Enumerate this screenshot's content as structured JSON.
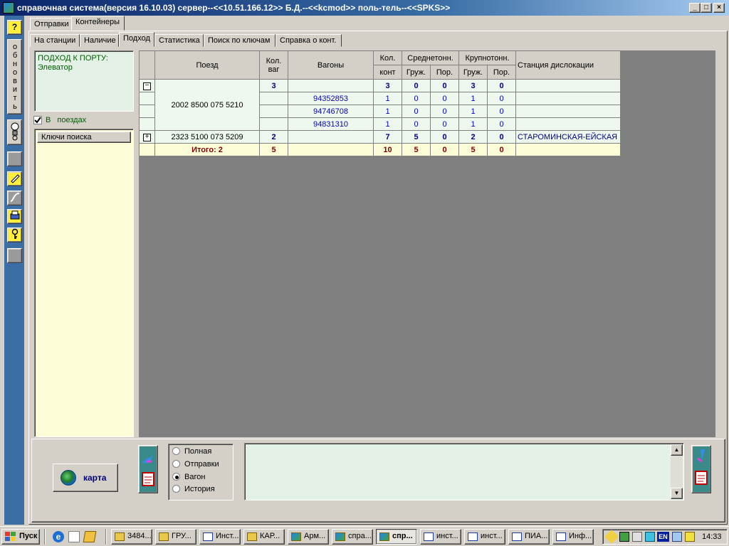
{
  "window": {
    "title": "справочная система(версия 16.10.03) сервер--<<10.51.166.12>> Б.Д.--<<kcmod>> поль-тель--<<SPKS>>",
    "min": "_",
    "max": "□",
    "close": "×"
  },
  "leftbar": {
    "help": "?",
    "refresh": "обновить"
  },
  "tabs": {
    "t1": "Отправки",
    "t2": "Контейнеры"
  },
  "subtabs": {
    "s1": "На станции",
    "s2": "Наличие",
    "s3": "Подход",
    "s4": "Статистика",
    "s5": "Поиск по ключам",
    "s6": "Справка о конт."
  },
  "info": {
    "line1": "ПОДХОД К ПОРТУ:",
    "line2": "Элеватор"
  },
  "checkbox": {
    "label": "В поездах",
    "checked": true
  },
  "keys": {
    "header": "Ключи поиска"
  },
  "table": {
    "h_train": "Поезд",
    "h_kolvag": "Кол. ваг",
    "h_wagons": "Вагоны",
    "h_kol": "Кол.",
    "h_kont": "конт",
    "h_mid": "Среднетонн.",
    "h_big": "Крупнотонн.",
    "h_gruzh": "Груж.",
    "h_por": "Пор.",
    "h_station": "Станция дислокации",
    "t1": {
      "train": "2002 8500 075 5210",
      "kolvag": "3",
      "kont": "3",
      "mg": "0",
      "mp": "0",
      "bg": "3",
      "bp": "0"
    },
    "w1": {
      "num": "94352853",
      "kont": "1",
      "mg": "0",
      "mp": "0",
      "bg": "1",
      "bp": "0"
    },
    "w2": {
      "num": "94746708",
      "kont": "1",
      "mg": "0",
      "mp": "0",
      "bg": "1",
      "bp": "0"
    },
    "w3": {
      "num": "94831310",
      "kont": "1",
      "mg": "0",
      "mp": "0",
      "bg": "1",
      "bp": "0"
    },
    "t2": {
      "train": "2323 5100 073 5209",
      "kolvag": "2",
      "kont": "7",
      "mg": "5",
      "mp": "0",
      "bg": "2",
      "bp": "0",
      "station": "СТАРОМИНСКАЯ-ЕЙСКАЯ"
    },
    "total": {
      "label": "Итого:  2",
      "kolvag": "5",
      "kont": "10",
      "mg": "5",
      "mp": "0",
      "bg": "5",
      "bp": "0"
    }
  },
  "karta": "карта",
  "radios": {
    "r1": "Полная",
    "r2": "Отправки",
    "r3": "Вагон",
    "r4": "История",
    "selected": "Вагон"
  },
  "taskbar": {
    "start": "Пуск",
    "t1": "3484...",
    "t2": "ГРУ...",
    "t3": "Инст...",
    "t4": "КАР...",
    "t5": "Арм...",
    "t6": "спра...",
    "t7": "спр...",
    "t8": "инст...",
    "t9": "инст...",
    "t10": "ПИА...",
    "t11": "Инф...",
    "lang": "EN",
    "clock": "14:33"
  }
}
